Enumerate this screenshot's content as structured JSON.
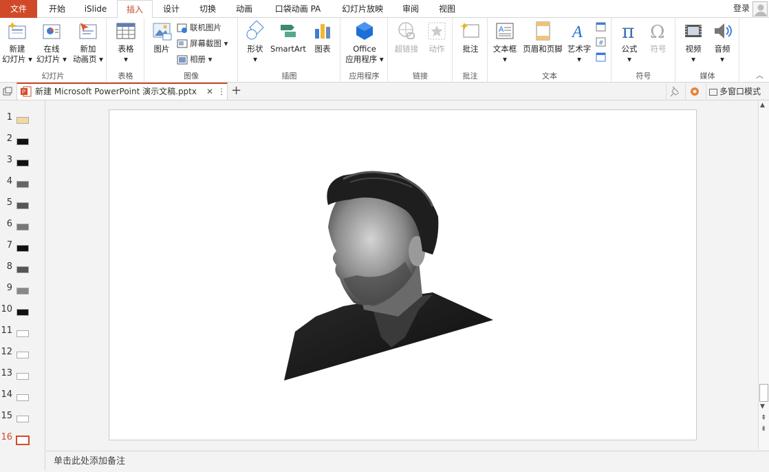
{
  "tabs": {
    "file": "文件",
    "home": "开始",
    "islide": "iSlide",
    "insert": "插入",
    "design": "设计",
    "transitions": "切换",
    "animations": "动画",
    "pocket": "口袋动画 PA",
    "slideshow": "幻灯片放映",
    "review": "审阅",
    "view": "视图"
  },
  "login": "登录",
  "ribbon": {
    "new_slide_1": "新建",
    "new_slide_2": "幻灯片",
    "online_slide_1": "在线",
    "online_slide_2": "幻灯片",
    "new_anim_1": "新加",
    "new_anim_2": "动画页",
    "group_slides": "幻灯片",
    "table": "表格",
    "group_table": "表格",
    "picture": "图片",
    "online_picture": "联机图片",
    "screenshot": "屏幕截图",
    "album": "相册",
    "group_images": "图像",
    "shapes": "形状",
    "smartart": "SmartArt",
    "chart": "图表",
    "group_illustrations": "插图",
    "office_1": "Office",
    "office_2": "应用程序",
    "group_apps": "应用程序",
    "hyperlink": "超链接",
    "action": "动作",
    "group_links": "链接",
    "comment": "批注",
    "group_comments": "批注",
    "textbox": "文本框",
    "header_footer": "页眉和页脚",
    "wordart": "艺术字",
    "group_text": "文本",
    "equation": "公式",
    "symbol": "符号",
    "group_symbols": "符号",
    "video": "视频",
    "audio": "音频",
    "group_media": "媒体"
  },
  "doc_tab": "新建 Microsoft PowerPoint 演示文稿.pptx",
  "multi_window": "多窗口模式",
  "slides": [
    {
      "n": "1",
      "bg": "#f4d7a1"
    },
    {
      "n": "2",
      "bg": "#111111"
    },
    {
      "n": "3",
      "bg": "#111111"
    },
    {
      "n": "4",
      "bg": "#666666"
    },
    {
      "n": "5",
      "bg": "#555555"
    },
    {
      "n": "6",
      "bg": "#777777"
    },
    {
      "n": "7",
      "bg": "#111111"
    },
    {
      "n": "8",
      "bg": "#555555"
    },
    {
      "n": "9",
      "bg": "#888888"
    },
    {
      "n": "10",
      "bg": "#111111"
    },
    {
      "n": "11",
      "bg": "#ffffff"
    },
    {
      "n": "12",
      "bg": "#ffffff"
    },
    {
      "n": "13",
      "bg": "#ffffff"
    },
    {
      "n": "14",
      "bg": "#ffffff"
    },
    {
      "n": "15",
      "bg": "#ffffff"
    },
    {
      "n": "16",
      "bg": "#ffffff"
    }
  ],
  "active_slide": "16",
  "notes_placeholder": "单击此处添加备注",
  "colors": {
    "accent": "#d04a2a"
  }
}
